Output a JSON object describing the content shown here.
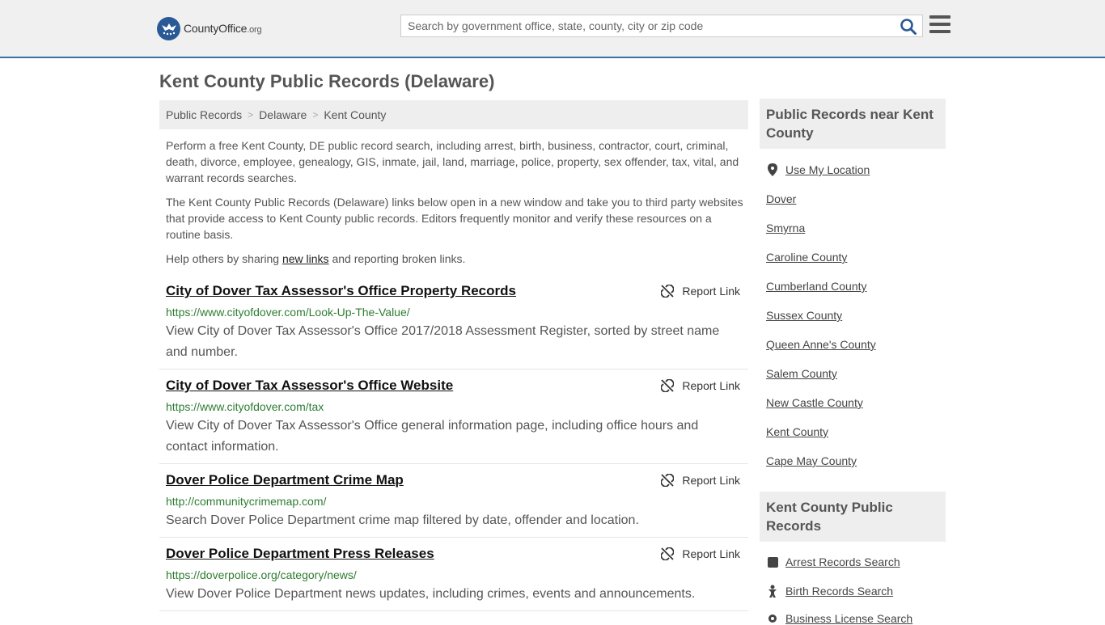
{
  "header": {
    "logo_text_main": "CountyOffice",
    "logo_text_org": ".org",
    "search_placeholder": "Search by government office, state, county, city or zip code"
  },
  "page_title": "Kent County Public Records (Delaware)",
  "breadcrumb": [
    "Public Records",
    "Delaware",
    "Kent County"
  ],
  "intro": {
    "p1": "Perform a free Kent County, DE public record search, including arrest, birth, business, contractor, court, criminal, death, divorce, employee, genealogy, GIS, inmate, jail, land, marriage, police, property, sex offender, tax, vital, and warrant records searches.",
    "p2": "The Kent County Public Records (Delaware) links below open in a new window and take you to third party websites that provide access to Kent County public records. Editors frequently monitor and verify these resources on a routine basis.",
    "p3_before": "Help others by sharing ",
    "p3_link": "new links",
    "p3_after": " and reporting broken links."
  },
  "report_label": "Report Link",
  "records": [
    {
      "title": "City of Dover Tax Assessor's Office Property Records",
      "url": "https://www.cityofdover.com/Look-Up-The-Value/",
      "desc": "View City of Dover Tax Assessor's Office 2017/2018 Assessment Register, sorted by street name and number."
    },
    {
      "title": "City of Dover Tax Assessor's Office Website",
      "url": "https://www.cityofdover.com/tax",
      "desc": "View City of Dover Tax Assessor's Office general information page, including office hours and contact information."
    },
    {
      "title": "Dover Police Department Crime Map",
      "url": "http://communitycrimemap.com/",
      "desc": "Search Dover Police Department crime map filtered by date, offender and location."
    },
    {
      "title": "Dover Police Department Press Releases",
      "url": "https://doverpolice.org/category/news/",
      "desc": "View Dover Police Department news updates, including crimes, events and announcements."
    }
  ],
  "sidebar": {
    "nearby_title": "Public Records near Kent County",
    "use_location": "Use My Location",
    "nearby": [
      "Dover",
      "Smyrna",
      "Caroline County",
      "Cumberland County",
      "Sussex County",
      "Queen Anne's County",
      "Salem County",
      "New Castle County",
      "Kent County",
      "Cape May County"
    ],
    "county_title": "Kent County Public Records",
    "county_links": [
      "Arrest Records Search",
      "Birth Records Search",
      "Business License Search"
    ]
  }
}
